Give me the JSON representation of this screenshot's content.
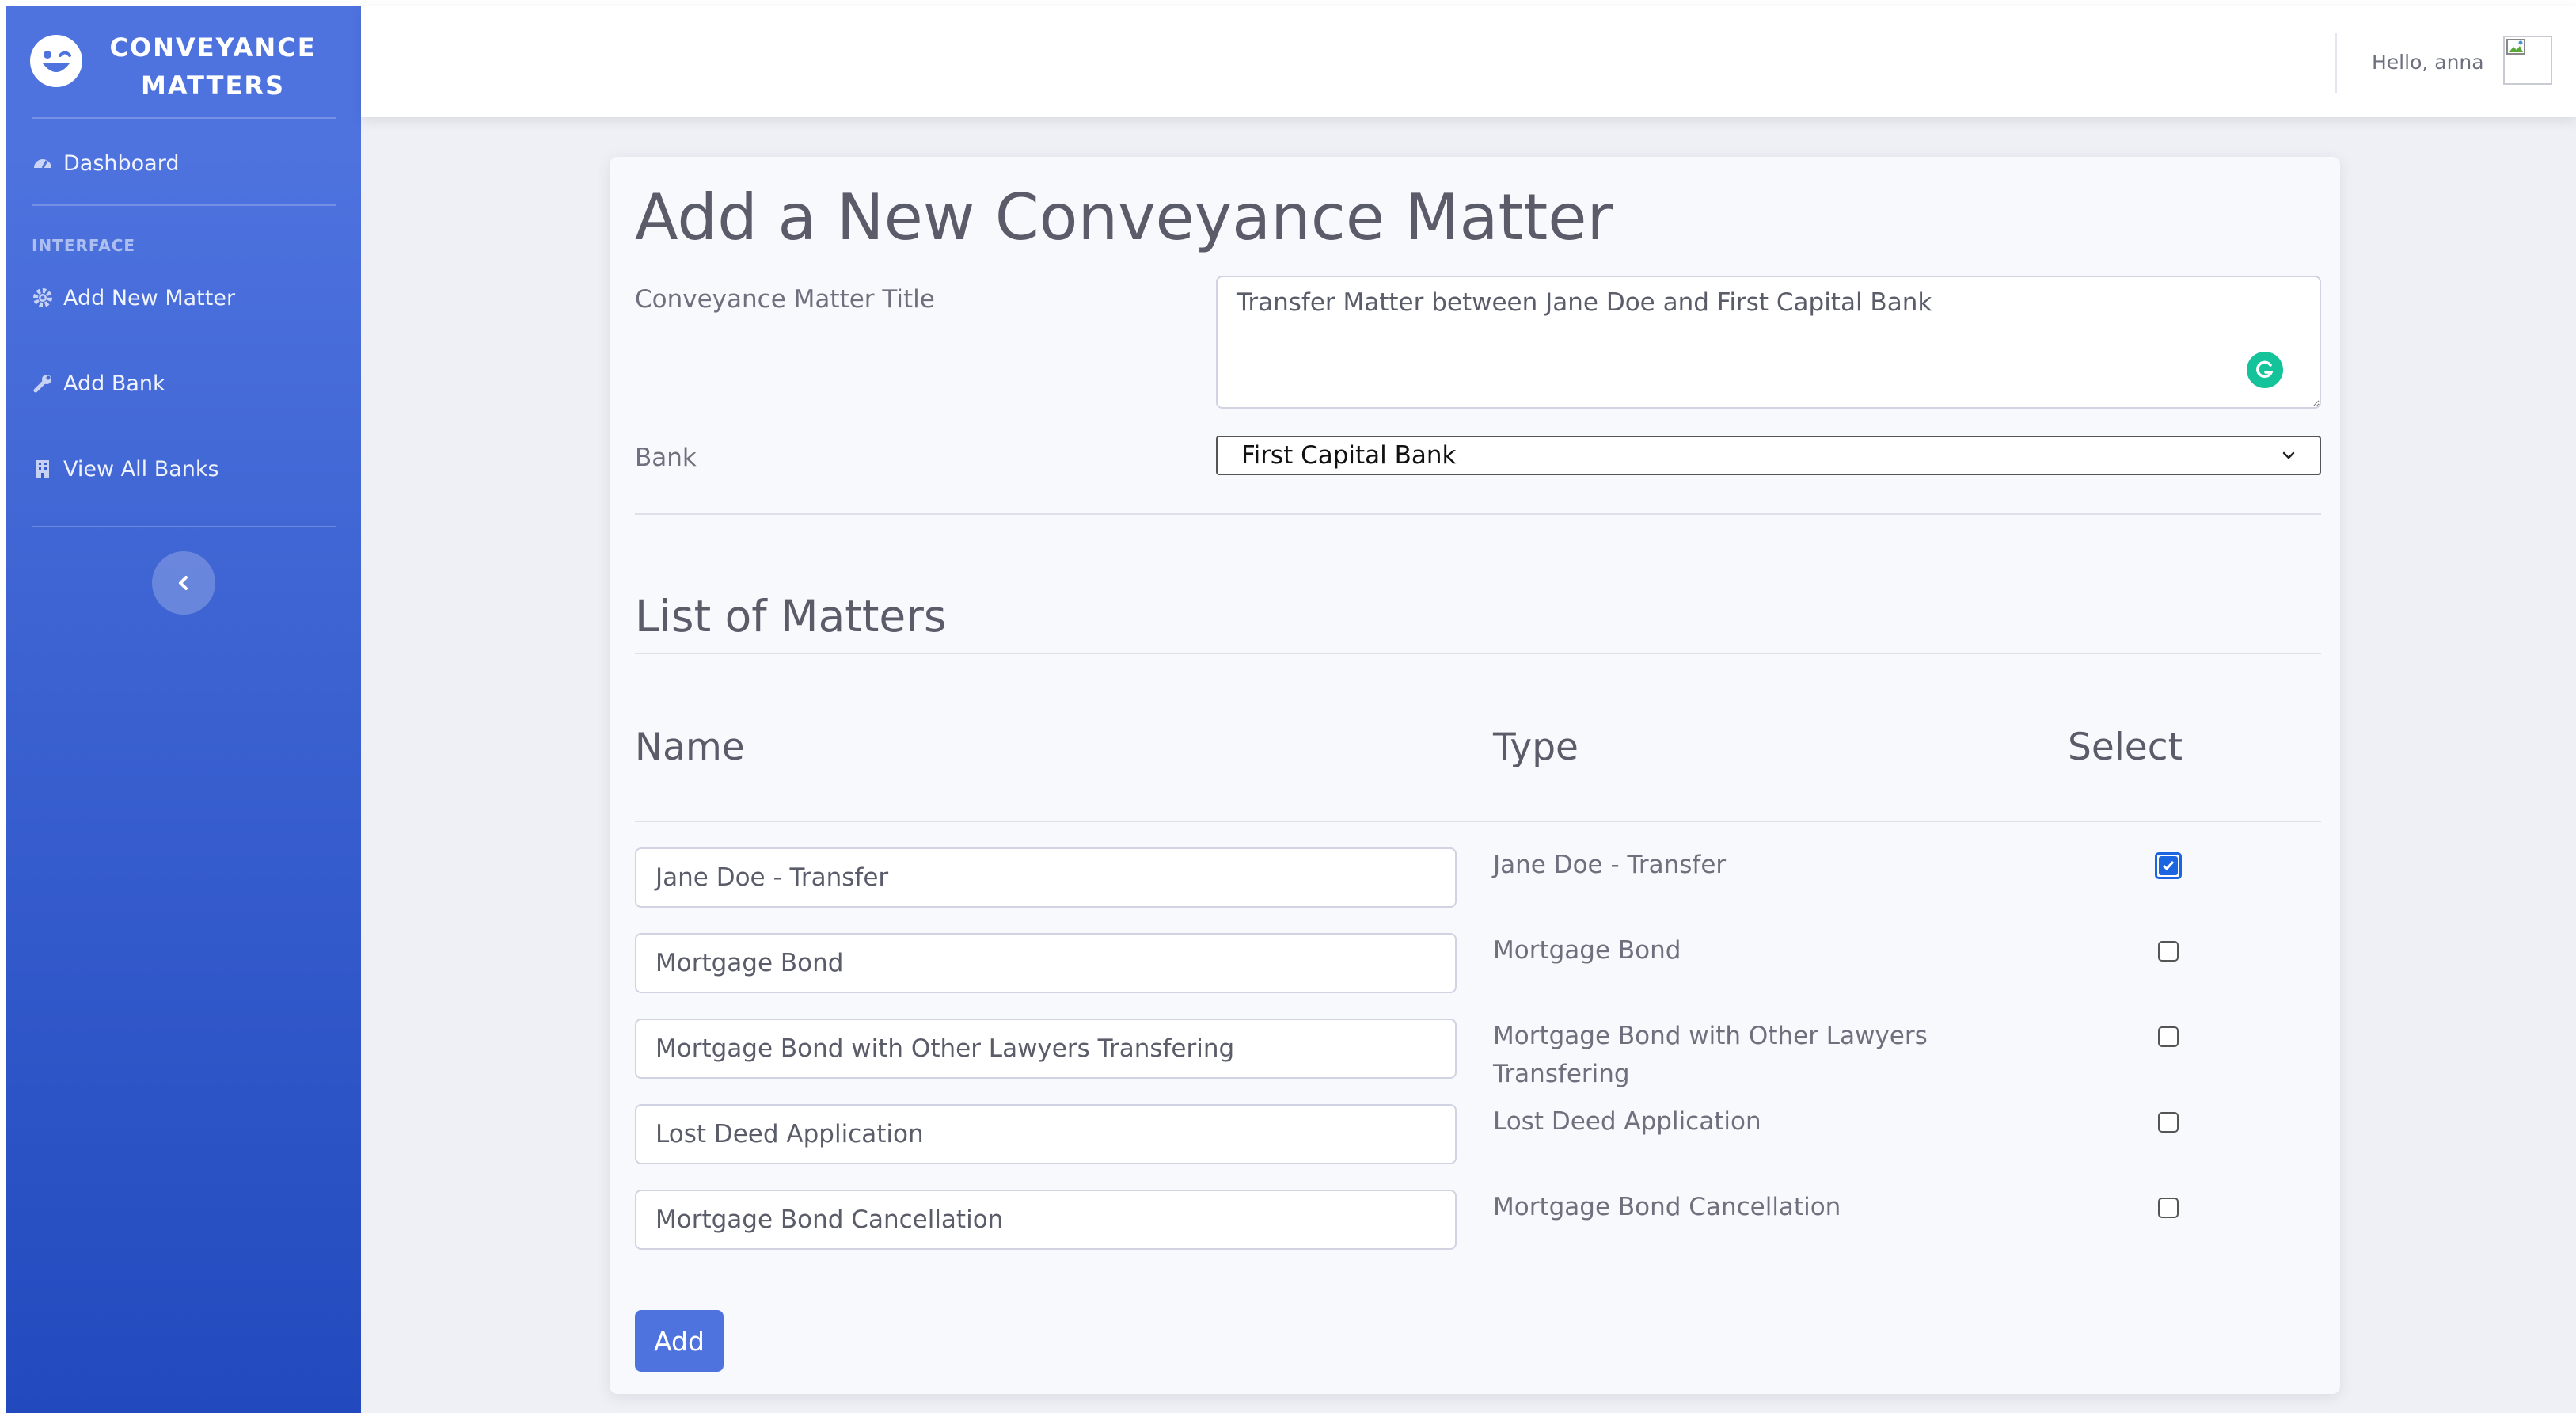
{
  "brand": {
    "line1": "CONVEYANCE",
    "line2": "MATTERS",
    "icon": "laugh-wink-icon"
  },
  "sidebar": {
    "dashboard": {
      "label": "Dashboard",
      "icon": "tachometer-icon"
    },
    "section_heading": "INTERFACE",
    "items": [
      {
        "label": "Add New Matter",
        "icon": "cog-icon"
      },
      {
        "label": "Add Bank",
        "icon": "wrench-icon"
      },
      {
        "label": "View All Banks",
        "icon": "building-icon"
      }
    ],
    "toggle_icon": "chevron-left-icon"
  },
  "topbar": {
    "greeting": "Hello, anna"
  },
  "form": {
    "page_title": "Add a New Conveyance Matter",
    "title_label": "Conveyance Matter Title",
    "title_value": "Transfer Matter between Jane Doe and First Capital Bank",
    "bank_label": "Bank",
    "bank_selected": "First Capital Bank"
  },
  "matters": {
    "section_title": "List of Matters",
    "headers": {
      "name": "Name",
      "type": "Type",
      "select": "Select"
    },
    "rows": [
      {
        "name": "Jane Doe - Transfer",
        "type": "Jane Doe - Transfer",
        "selected": true
      },
      {
        "name": "Mortgage Bond",
        "type": "Mortgage Bond",
        "selected": false
      },
      {
        "name": "Mortgage Bond with Other Lawyers Transfering",
        "type": "Mortgage Bond with Other Lawyers Transfering",
        "selected": false
      },
      {
        "name": "Lost Deed Application",
        "type": "Lost Deed Application",
        "selected": false
      },
      {
        "name": "Mortgage Bond Cancellation",
        "type": "Mortgage Bond Cancellation",
        "selected": false
      }
    ],
    "add_button": "Add"
  },
  "colors": {
    "primary": "#4e73df",
    "primary_dark": "#224abe",
    "checkbox": "#1b66e0",
    "grammarly": "#15c39a"
  }
}
